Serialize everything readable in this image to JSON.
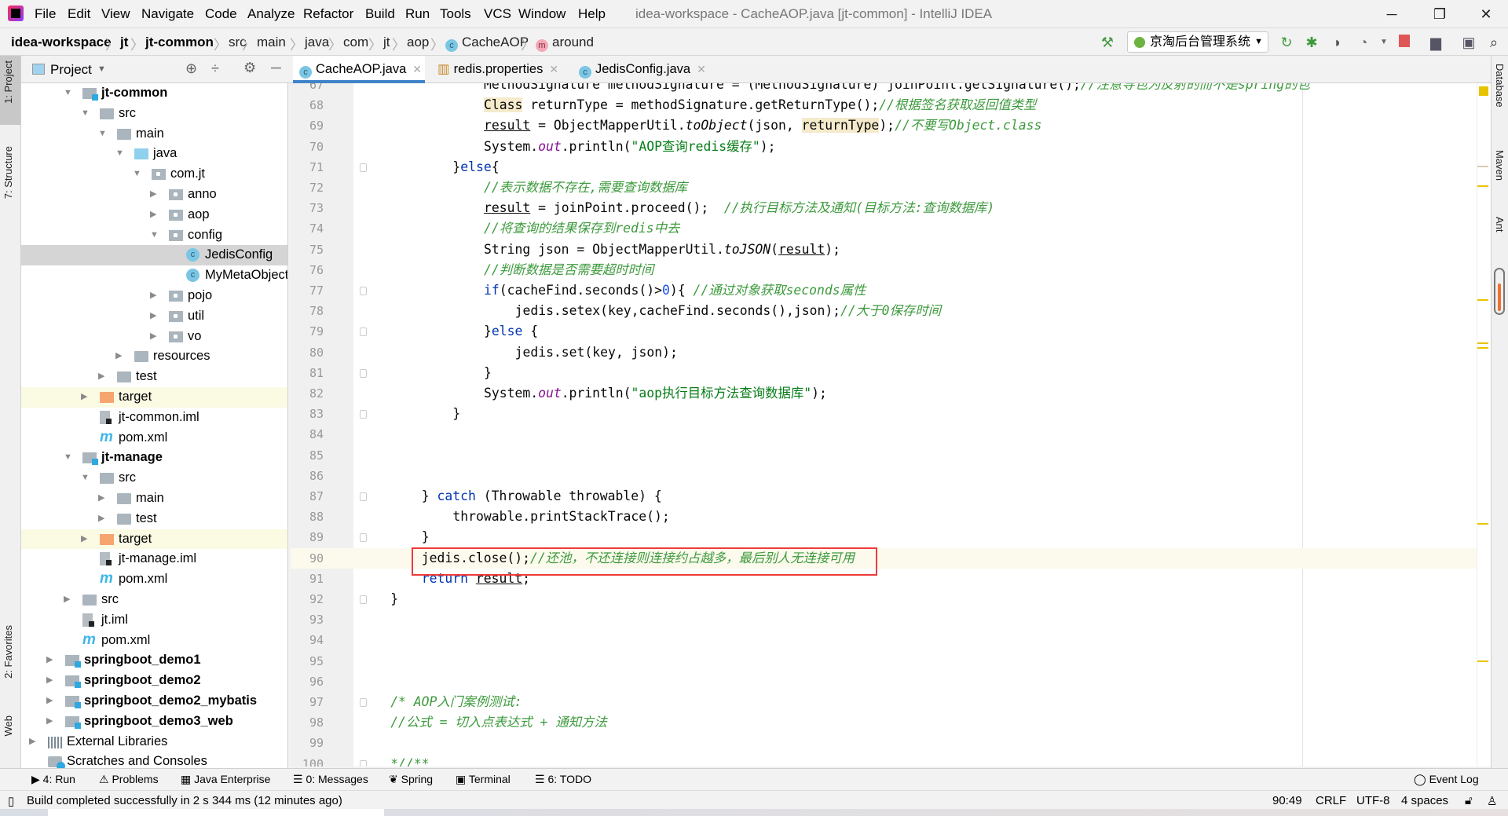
{
  "window": {
    "title": "idea-workspace - CacheAOP.java [jt-common] - IntelliJ IDEA",
    "menu": [
      "File",
      "Edit",
      "View",
      "Navigate",
      "Code",
      "Analyze",
      "Refactor",
      "Build",
      "Run",
      "Tools",
      "VCS",
      "Window",
      "Help"
    ],
    "controls": {
      "minimize": "─",
      "restore": "❐",
      "close": "✕"
    }
  },
  "breadcrumb": [
    {
      "label": "idea-workspace",
      "bold": true
    },
    {
      "label": "jt",
      "bold": true
    },
    {
      "label": "jt-common",
      "bold": true
    },
    {
      "label": "src"
    },
    {
      "label": "main"
    },
    {
      "label": "java"
    },
    {
      "label": "com"
    },
    {
      "label": "jt"
    },
    {
      "label": "aop"
    },
    {
      "label": "CacheAOP",
      "icon": "class-icon"
    },
    {
      "label": "around",
      "icon": "method-icon"
    }
  ],
  "toolbar": {
    "run_config": "京淘后台管理系统",
    "icons": [
      "build-hammer-icon",
      "rerun-icon",
      "debug-icon",
      "coverage-icon",
      "profile-icon",
      "stop-icon",
      "project-structure-icon",
      "terminal-window-icon",
      "search-icon"
    ]
  },
  "project_panel": {
    "title": "Project",
    "tree": [
      {
        "label": "jt-common",
        "level": 2,
        "icon": "module",
        "state": "open",
        "bold": true
      },
      {
        "label": "src",
        "level": 3,
        "icon": "folder",
        "state": "open"
      },
      {
        "label": "main",
        "level": 4,
        "icon": "folder",
        "state": "open"
      },
      {
        "label": "java",
        "level": 5,
        "icon": "src",
        "state": "open"
      },
      {
        "label": "com.jt",
        "level": 6,
        "icon": "pkg",
        "state": "open"
      },
      {
        "label": "anno",
        "level": 7,
        "icon": "pkg",
        "state": "closed"
      },
      {
        "label": "aop",
        "level": 7,
        "icon": "pkg",
        "state": "closed"
      },
      {
        "label": "config",
        "level": 7,
        "icon": "pkg",
        "state": "open"
      },
      {
        "label": "JedisConfig",
        "level": 8,
        "icon": "class",
        "selected": true
      },
      {
        "label": "MyMetaObjectI",
        "level": 8,
        "icon": "class"
      },
      {
        "label": "pojo",
        "level": 7,
        "icon": "pkg",
        "state": "closed"
      },
      {
        "label": "util",
        "level": 7,
        "icon": "pkg",
        "state": "closed"
      },
      {
        "label": "vo",
        "level": 7,
        "icon": "pkg",
        "state": "closed"
      },
      {
        "label": "resources",
        "level": 5,
        "icon": "folder",
        "state": "closed"
      },
      {
        "label": "test",
        "level": 4,
        "icon": "folder",
        "state": "closed"
      },
      {
        "label": "target",
        "level": 3,
        "icon": "target",
        "state": "closed",
        "excluded": true
      },
      {
        "label": "jt-common.iml",
        "level": 3,
        "icon": "iml"
      },
      {
        "label": "pom.xml",
        "level": 3,
        "icon": "maven"
      },
      {
        "label": "jt-manage",
        "level": 2,
        "icon": "module",
        "state": "open",
        "bold": true
      },
      {
        "label": "src",
        "level": 3,
        "icon": "folder",
        "state": "open"
      },
      {
        "label": "main",
        "level": 4,
        "icon": "folder",
        "state": "closed"
      },
      {
        "label": "test",
        "level": 4,
        "icon": "folder",
        "state": "closed"
      },
      {
        "label": "target",
        "level": 3,
        "icon": "target",
        "state": "closed",
        "excluded": true
      },
      {
        "label": "jt-manage.iml",
        "level": 3,
        "icon": "iml"
      },
      {
        "label": "pom.xml",
        "level": 3,
        "icon": "maven"
      },
      {
        "label": "src",
        "level": 2,
        "icon": "folder",
        "state": "closed"
      },
      {
        "label": "jt.iml",
        "level": 2,
        "icon": "iml"
      },
      {
        "label": "pom.xml",
        "level": 2,
        "icon": "maven"
      },
      {
        "label": "springboot_demo1",
        "level": 1,
        "icon": "module",
        "state": "closed",
        "bold": true
      },
      {
        "label": "springboot_demo2",
        "level": 1,
        "icon": "module",
        "state": "closed",
        "bold": true
      },
      {
        "label": "springboot_demo2_mybatis",
        "level": 1,
        "icon": "module",
        "state": "closed",
        "bold": true
      },
      {
        "label": "springboot_demo3_web",
        "level": 1,
        "icon": "module",
        "state": "closed",
        "bold": true
      },
      {
        "label": "External Libraries",
        "level": 0,
        "icon": "lib",
        "state": "closed"
      },
      {
        "label": "Scratches and Consoles",
        "level": 0,
        "icon": "scratch"
      }
    ]
  },
  "tabs": [
    {
      "label": "CacheAOP.java",
      "icon": "class-icon",
      "active": true
    },
    {
      "label": "redis.properties",
      "icon": "properties-icon"
    },
    {
      "label": "JedisConfig.java",
      "icon": "class-icon"
    }
  ],
  "editor": {
    "current_line": 90,
    "lines": [
      {
        "n": 67,
        "indent": 20,
        "tokens": [
          [
            "MethodSignature methodSignature = (MethodSignature) joinPoint.getSignature();",
            ""
          ],
          [
            "//注意导包为反射的而不是spring的包",
            "c"
          ]
        ]
      },
      {
        "n": 68,
        "indent": 20,
        "tokens": [
          [
            "Class",
            "h"
          ],
          [
            " returnType = methodSignature.getReturnType();",
            ""
          ],
          [
            "//根据签名获取返回值类型",
            "c"
          ]
        ]
      },
      {
        "n": 69,
        "indent": 20,
        "tokens": [
          [
            "result",
            "u"
          ],
          [
            " = ObjectMapperUtil.",
            ""
          ],
          [
            "toObject",
            "i"
          ],
          [
            "(json, ",
            ""
          ],
          [
            "returnType",
            "h"
          ],
          [
            ");",
            ""
          ],
          [
            "//不要写Object.class",
            "c"
          ]
        ]
      },
      {
        "n": 70,
        "indent": 20,
        "tokens": [
          [
            "System.",
            ""
          ],
          [
            "out",
            "f"
          ],
          [
            ".println(",
            ""
          ],
          [
            "\"AOP查询redis缓存\"",
            "s"
          ],
          [
            ");",
            ""
          ]
        ]
      },
      {
        "n": 71,
        "indent": 16,
        "fold": true,
        "tokens": [
          [
            "}",
            ""
          ],
          [
            "else",
            "k"
          ],
          [
            "{",
            ""
          ]
        ]
      },
      {
        "n": 72,
        "indent": 20,
        "tokens": [
          [
            "//表示数据不存在,需要查询数据库",
            "c"
          ]
        ]
      },
      {
        "n": 73,
        "indent": 20,
        "tokens": [
          [
            "result",
            "u"
          ],
          [
            " = joinPoint.proceed();  ",
            ""
          ],
          [
            "//执行目标方法及通知(目标方法:查询数据库)",
            "c"
          ]
        ]
      },
      {
        "n": 74,
        "indent": 20,
        "tokens": [
          [
            "//将查询的结果保存到redis中去",
            "c"
          ]
        ]
      },
      {
        "n": 75,
        "indent": 20,
        "tokens": [
          [
            "String json = ObjectMapperUtil.",
            ""
          ],
          [
            "toJSON",
            "i"
          ],
          [
            "(",
            ""
          ],
          [
            "result",
            "u"
          ],
          [
            ");",
            ""
          ]
        ]
      },
      {
        "n": 76,
        "indent": 20,
        "tokens": [
          [
            "//判断数据是否需要超时时间",
            "c"
          ]
        ]
      },
      {
        "n": 77,
        "indent": 20,
        "fold": true,
        "tokens": [
          [
            "if",
            "k"
          ],
          [
            "(cacheFind.seconds()>",
            ""
          ],
          [
            "0",
            "n"
          ],
          [
            "){ ",
            ""
          ],
          [
            "//通过对象获取seconds属性",
            "c"
          ]
        ]
      },
      {
        "n": 78,
        "indent": 24,
        "tokens": [
          [
            "jedis.setex(key,cacheFind.seconds(),json);",
            ""
          ],
          [
            "//大于0保存时间",
            "c"
          ]
        ]
      },
      {
        "n": 79,
        "indent": 20,
        "fold": true,
        "tokens": [
          [
            "}",
            ""
          ],
          [
            "else",
            "k"
          ],
          [
            " {",
            ""
          ]
        ]
      },
      {
        "n": 80,
        "indent": 24,
        "tokens": [
          [
            "jedis.set(key, json);",
            ""
          ]
        ]
      },
      {
        "n": 81,
        "indent": 20,
        "fold": true,
        "tokens": [
          [
            "}",
            ""
          ]
        ]
      },
      {
        "n": 82,
        "indent": 20,
        "tokens": [
          [
            "System.",
            ""
          ],
          [
            "out",
            "f"
          ],
          [
            ".println(",
            ""
          ],
          [
            "\"aop执行目标方法查询数据库\"",
            "s"
          ],
          [
            ");",
            ""
          ]
        ]
      },
      {
        "n": 83,
        "indent": 16,
        "fold": true,
        "tokens": [
          [
            "}",
            ""
          ]
        ]
      },
      {
        "n": 84,
        "indent": 0,
        "tokens": []
      },
      {
        "n": 85,
        "indent": 0,
        "tokens": []
      },
      {
        "n": 86,
        "indent": 0,
        "tokens": []
      },
      {
        "n": 87,
        "indent": 12,
        "fold": true,
        "tokens": [
          [
            "} ",
            ""
          ],
          [
            "catch",
            "k"
          ],
          [
            " (Throwable throwable) {",
            ""
          ]
        ]
      },
      {
        "n": 88,
        "indent": 16,
        "tokens": [
          [
            "throwable.printStackTrace();",
            ""
          ]
        ]
      },
      {
        "n": 89,
        "indent": 12,
        "fold": true,
        "tokens": [
          [
            "}",
            ""
          ]
        ]
      },
      {
        "n": 90,
        "indent": 12,
        "tokens": [
          [
            "jedis.close();",
            ""
          ],
          [
            "//还池，不还连接则连接约占越多，最后别人无连接可用",
            "c"
          ]
        ]
      },
      {
        "n": 91,
        "indent": 12,
        "tokens": [
          [
            "return",
            "k"
          ],
          [
            " ",
            ""
          ],
          [
            "result",
            "u"
          ],
          [
            ";",
            ""
          ]
        ]
      },
      {
        "n": 92,
        "indent": 8,
        "fold": true,
        "tokens": [
          [
            "}",
            ""
          ]
        ]
      },
      {
        "n": 93,
        "indent": 0,
        "tokens": []
      },
      {
        "n": 94,
        "indent": 0,
        "tokens": []
      },
      {
        "n": 95,
        "indent": 0,
        "tokens": []
      },
      {
        "n": 96,
        "indent": 0,
        "tokens": []
      },
      {
        "n": 97,
        "indent": 8,
        "fold": true,
        "tokens": [
          [
            "/* AOP入门案例测试:",
            "c"
          ]
        ]
      },
      {
        "n": 98,
        "indent": 8,
        "tokens": [
          [
            "//公式 = 切入点表达式 + 通知方法",
            "c"
          ]
        ]
      },
      {
        "n": 99,
        "indent": 0,
        "tokens": []
      },
      {
        "n": 100,
        "indent": 8,
        "fold": true,
        "tokens": [
          [
            "*//**",
            "c"
          ]
        ]
      }
    ]
  },
  "left_strip": [
    "1: Project",
    "7: Structure",
    "2: Favorites",
    "Web"
  ],
  "right_strip": [
    "Database",
    "Maven",
    "Ant"
  ],
  "tool_windows": [
    "4: Run",
    "Problems",
    "Java Enterprise",
    "0: Messages",
    "Spring",
    "Terminal",
    "6: TODO"
  ],
  "event_log": "Event Log",
  "status": {
    "message": "Build completed successfully in 2 s 344 ms (12 minutes ago)",
    "position": "90:49",
    "line_separator": "CRLF",
    "encoding": "UTF-8",
    "indent": "4 spaces"
  },
  "colors": {
    "accent": "#4083c9",
    "highlight_box": "#ef3a3a",
    "comment": "#3d9a3d",
    "string": "#067d17",
    "keyword": "#0033b3"
  }
}
